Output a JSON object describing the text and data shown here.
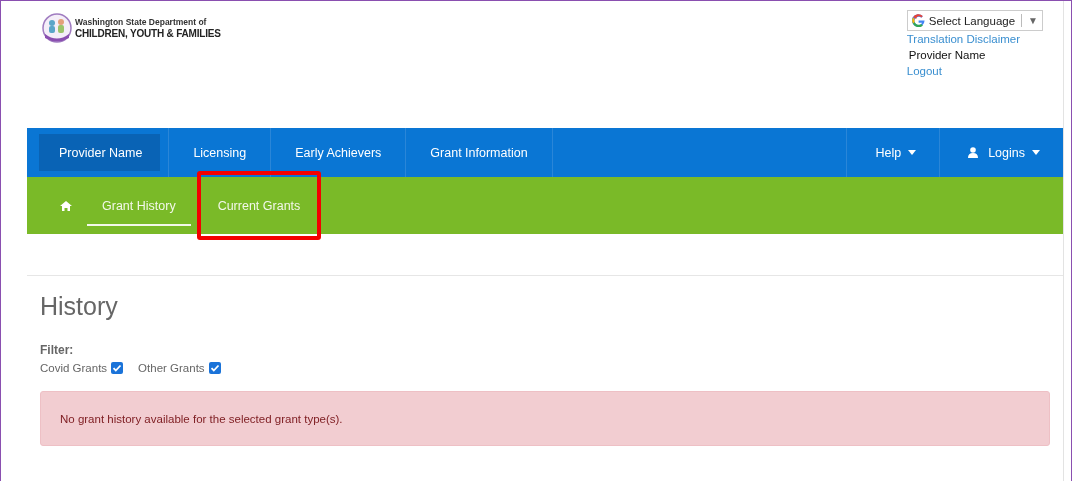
{
  "header": {
    "logo": {
      "line_1": "Washington State Department of",
      "line_2": "CHILDREN, YOUTH & FAMILIES"
    },
    "language": {
      "label": "Select Language",
      "caret": "▼"
    },
    "links": [
      {
        "kind": "link",
        "text": "Translation Disclaimer"
      },
      {
        "kind": "text",
        "text": "Provider Name"
      },
      {
        "kind": "link",
        "text": "Logout"
      }
    ]
  },
  "nav": {
    "items": [
      {
        "label": "Provider Name",
        "selected": true
      },
      {
        "label": "Licensing",
        "selected": false
      },
      {
        "label": "Early Achievers",
        "selected": false
      },
      {
        "label": "Grant Information",
        "selected": false
      }
    ],
    "right_items": [
      {
        "kind": "dropdown",
        "label": "Help"
      },
      {
        "kind": "user-dropdown",
        "label": "Logins"
      }
    ]
  },
  "subnav": {
    "items": [
      {
        "kind": "home",
        "selected": false
      },
      {
        "kind": "link",
        "label": "Grant History",
        "selected": true,
        "highlighted": false
      },
      {
        "kind": "link",
        "label": "Current Grants",
        "selected": false,
        "highlighted": true
      }
    ]
  },
  "page": {
    "title": "History",
    "filter_label": "Filter:",
    "filters": [
      {
        "label": "Covid Grants",
        "checked": true
      },
      {
        "label": "Other Grants",
        "checked": true
      }
    ],
    "alert": "No grant history available for the selected grant type(s)."
  }
}
